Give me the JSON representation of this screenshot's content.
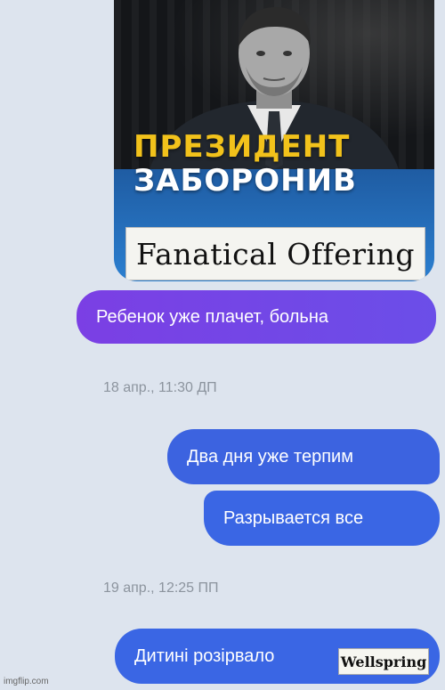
{
  "image_message": {
    "poster_line1": "ПРЕЗИДЕНТ",
    "poster_line2": "ЗАБОРОНИВ",
    "sticker_text": "Fanatical Offering"
  },
  "messages": [
    {
      "text": "Ребенок уже плачет, больна"
    },
    {
      "text": "Два дня уже терпим"
    },
    {
      "text": "Разрывается все"
    },
    {
      "text": "Дитині розірвало"
    }
  ],
  "timestamps": [
    "18 апр., 11:30 ДП",
    "19 апр., 12:25 ПП"
  ],
  "stamp_text": "Wellspring",
  "watermark": "imgflip.com",
  "colors": {
    "background": "#dde4ee",
    "purple_bubble": "#7b3fe4",
    "blue_bubble": "#3a66e4",
    "poster_yellow": "#f2c21b"
  }
}
